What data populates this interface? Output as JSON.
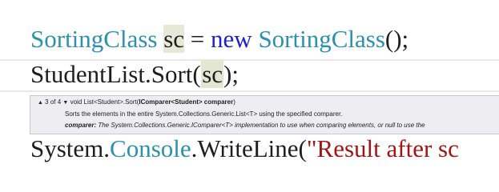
{
  "code": {
    "line1": {
      "type1": "SortingClass",
      "var": "sc",
      "eq": " = ",
      "kw_new": "new",
      "type2": "SortingClass",
      "end": "();"
    },
    "line2": {
      "obj": "StudentList.Sort(",
      "arg": "sc",
      "end": ");"
    },
    "line3": {
      "prefix": "System.",
      "console": "Console",
      "method": ".WriteLine(",
      "string": "\"Result after sc"
    }
  },
  "tooltip": {
    "up_arrow": "▲",
    "counter": "3 of 4",
    "down_arrow": "▼",
    "signature_prefix": "void List<Student>.Sort(",
    "param_signature": "IComparer<Student> comparer",
    "signature_suffix": ")",
    "description": "Sorts the elements in the entire System.Collections.Generic.List<T> using the specified comparer.",
    "param_name": "comparer:",
    "param_description": " The System.Collections.Generic.IComparer<T> implementation to use when comparing elements, or null to use the"
  },
  "colors": {
    "type": "#2b91af",
    "keyword": "#1f1fd1",
    "string": "#a31515",
    "highlight": "#e6e8d8",
    "tooltip_bg": "#eeeef2"
  }
}
